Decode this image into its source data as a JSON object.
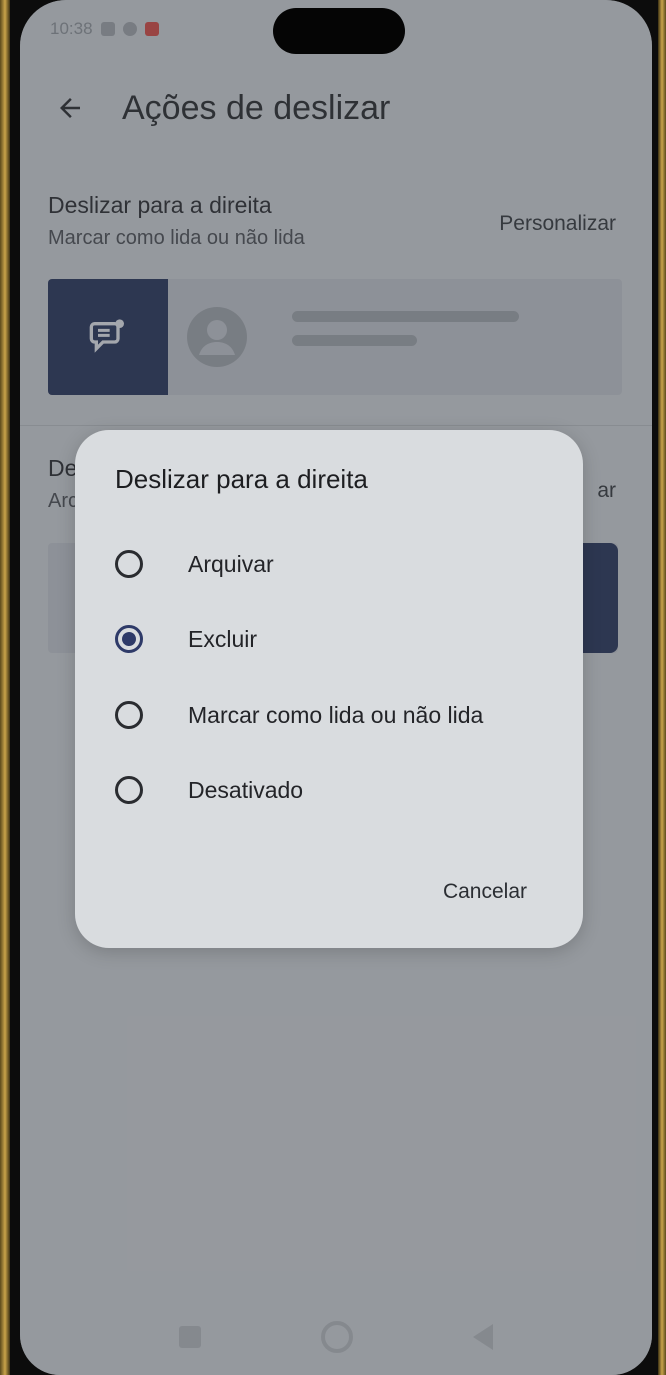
{
  "status_bar": {
    "time": "10:38"
  },
  "header": {
    "title": "Ações de deslizar"
  },
  "swipe_right": {
    "title": "Deslizar para a direita",
    "current_value": "Marcar como lida ou não lida",
    "customize_label": "Personalizar"
  },
  "swipe_left": {
    "title_partial": "De",
    "value_partial": "Arc",
    "customize_partial": "ar"
  },
  "dialog": {
    "title": "Deslizar para a direita",
    "options": [
      {
        "label": "Arquivar",
        "selected": false
      },
      {
        "label": "Excluir",
        "selected": true
      },
      {
        "label": "Marcar como lida ou não lida",
        "selected": false
      },
      {
        "label": "Desativado",
        "selected": false
      }
    ],
    "cancel_label": "Cancelar"
  },
  "colors": {
    "accent": "#2e3a68",
    "swipe_action_bg": "#1d2a52",
    "status_notification": "#d6403a"
  },
  "icons": {
    "back": "arrow-left-icon",
    "swipe_action": "mark-read-unread-icon",
    "avatar": "person-avatar-icon"
  }
}
